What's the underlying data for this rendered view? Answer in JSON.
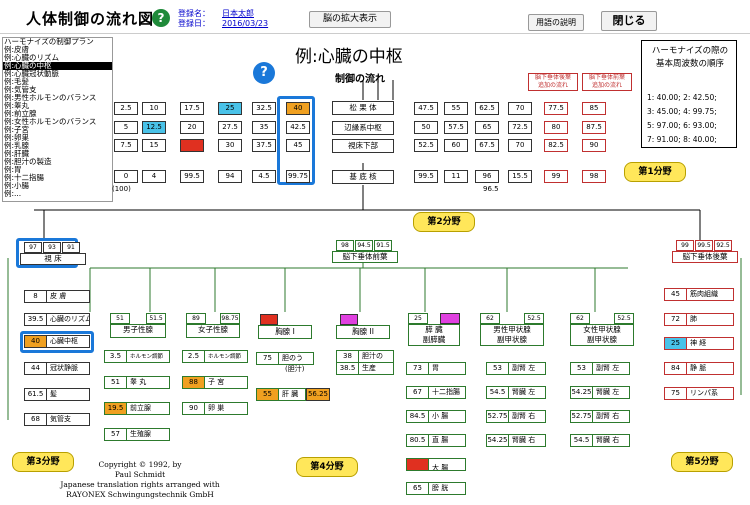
{
  "header": {
    "title": "人体制御の流れ図",
    "reg_labels": [
      "登録名：",
      "登録日："
    ],
    "reg_values": [
      "日本太郎",
      "2016/03/23"
    ],
    "zoom_button": "脳の拡大表示",
    "terms_button": "用語の説明",
    "close_button": "閉じる"
  },
  "side_list": [
    "ハーモナイズの制御プラン",
    "例:皮膚",
    "例:心臓のリズム",
    "例:心臓の中枢",
    "例:心臓冠状動脈",
    "例:毛髪",
    "例:気管支",
    "例:男性ホルモンのバランス",
    "例:睾丸",
    "例:前立腺",
    "例:女性ホルモンのバランス",
    "例:子宮",
    "例:卵巣",
    "例:乳腺",
    "例:肝臓",
    "例:胆汁の製造",
    "例:胃",
    "例:十二指腸",
    "例:小腸",
    "例:..."
  ],
  "side_selected": 3,
  "main_title": "例:心臓の中枢",
  "flow_label": "制御の流れ",
  "legend": {
    "title": [
      "ハーモナイズの際の",
      "基本周波数の順序"
    ],
    "rows": [
      "1:  40.00;    2:  42.50;",
      "3:  45.00;    4:  99.75;",
      "5:  97.00;    6:  93.00;",
      "7:  91.00;    8:  40.00;"
    ]
  },
  "grid": {
    "rows": [
      [
        "2.5",
        "10",
        "17.5",
        "25",
        "32.5",
        "40"
      ],
      [
        "5",
        "12.5",
        "20",
        "27.5",
        "35",
        "42.5"
      ],
      [
        "7.5",
        "15",
        "",
        "30",
        "37.5",
        "45"
      ],
      [
        "0",
        "4",
        "99.5",
        "94",
        "4.5",
        "99.75"
      ]
    ],
    "extra": "(100)",
    "right_rows": [
      [
        "47.5",
        "55",
        "62.5",
        "70",
        "77.5",
        "85"
      ],
      [
        "50",
        "57.5",
        "65",
        "72.5",
        "80",
        "87.5"
      ],
      [
        "52.5",
        "60",
        "67.5",
        "70",
        "82.5",
        "90"
      ],
      [
        "99.5",
        "11",
        "96",
        "15.5",
        "99",
        "98"
      ]
    ],
    "right_extra": "96.5",
    "center": [
      "松 果 体",
      "辺縁系中枢",
      "視床下部",
      "基 底 核"
    ],
    "tag_left": [
      "脳下垂体後葉",
      "追加の流れ"
    ],
    "tag_right": [
      "脳下垂体前葉",
      "追加の流れ"
    ]
  },
  "fields": [
    "第1分野",
    "第2分野",
    "第3分野",
    "第4分野",
    "第5分野"
  ],
  "pituitary_front": {
    "values": [
      "98",
      "94.5",
      "91.5"
    ],
    "label": "脳下垂体前葉"
  },
  "pituitary_back": {
    "values": [
      "99",
      "99.5",
      "92.5"
    ],
    "label": "脳下垂体後葉"
  },
  "thalamus": {
    "values": [
      "97",
      "93",
      "91"
    ],
    "label": "視 床"
  },
  "left_organs": [
    [
      "8",
      "皮 膚"
    ],
    [
      "39.5",
      "心臓のリズム"
    ],
    [
      "40",
      "心臓中枢"
    ],
    [
      "44",
      "冠状静脈"
    ],
    [
      "61.5",
      "髪"
    ],
    [
      "68",
      "気管支"
    ]
  ],
  "right_organs": [
    [
      "45",
      "筋肉組織"
    ],
    [
      "72",
      "肺"
    ],
    [
      "25",
      "神 経"
    ],
    [
      "84",
      "静 脈"
    ],
    [
      "75",
      "リンパ系"
    ]
  ],
  "male": {
    "values": [
      "51",
      "51.5"
    ],
    "label": "男子性腺",
    "items": [
      [
        "3.5",
        "ホルモン調節"
      ],
      [
        "51",
        "睾 丸"
      ],
      [
        "19.5",
        "前立腺"
      ],
      [
        "57",
        "生殖腺"
      ]
    ]
  },
  "female": {
    "values": [
      "89",
      "98.75"
    ],
    "label": "女子性腺",
    "items": [
      [
        "2.5",
        "ホルモン調節"
      ],
      [
        "88",
        "子 宮"
      ],
      [
        "90",
        "卵 巣"
      ]
    ]
  },
  "breast1": {
    "label": "胸腺 I",
    "items": [
      [
        "75",
        "胆のう"
      ],
      [
        "55",
        "肝 臓"
      ]
    ],
    "bile": "(胆汁)",
    "liver_val": "56.25"
  },
  "breast2": {
    "label": "胸腺 II",
    "items": [
      [
        "38",
        "胆汁の"
      ],
      [
        "38.5",
        "生産"
      ]
    ]
  },
  "pancreas": {
    "values": [
      "25",
      ""
    ],
    "label": [
      "膵 臓",
      "副膵臓"
    ],
    "items": [
      [
        "73",
        "胃"
      ],
      [
        "67",
        "十二指腸"
      ],
      [
        "84.5",
        "小 腸"
      ],
      [
        "80.5",
        "直 腸"
      ],
      [
        "",
        "大 腸"
      ],
      [
        "65",
        "膀 胱"
      ]
    ]
  },
  "male_thyroid": {
    "values": [
      "62",
      "52.5"
    ],
    "label": [
      "男性甲状腺",
      "副甲状腺"
    ],
    "items": [
      [
        "53",
        "副腎 左"
      ],
      [
        "54.5",
        "腎臓 左"
      ],
      [
        "52.75",
        "副腎 右"
      ],
      [
        "54.25",
        "腎臓 右"
      ]
    ]
  },
  "female_thyroid": {
    "values": [
      "62",
      "52.5"
    ],
    "label": [
      "女性甲状腺",
      "副甲状腺"
    ],
    "items": [
      [
        "53",
        "副腎 左"
      ],
      [
        "54.25",
        "腎臓 左"
      ],
      [
        "52.75",
        "副腎 右"
      ],
      [
        "54.5",
        "腎臓 右"
      ]
    ]
  },
  "copyright": [
    "Copyright © 1992, by",
    "Paul  Schmidt",
    "Japanese translation rights arranged with",
    "RAYONEX Schwingungstechnik GmbH"
  ]
}
